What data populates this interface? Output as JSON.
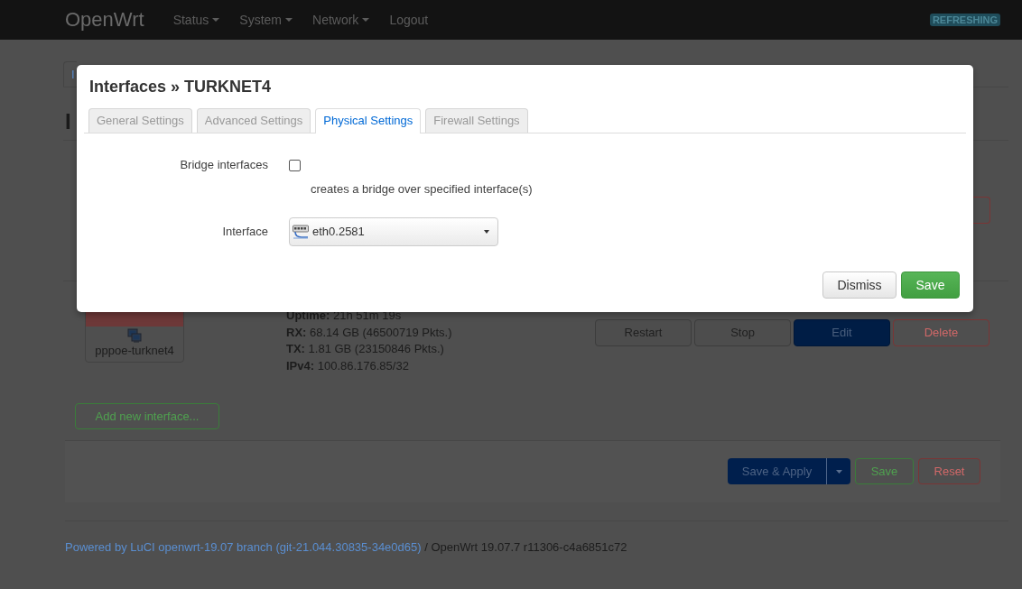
{
  "navbar": {
    "brand": "OpenWrt",
    "menu": [
      {
        "label": "Status",
        "dropdown": true
      },
      {
        "label": "System",
        "dropdown": true
      },
      {
        "label": "Network",
        "dropdown": true
      },
      {
        "label": "Logout",
        "dropdown": false
      }
    ],
    "badge": "REFRESHING"
  },
  "page": {
    "tabs": [
      {
        "label": "I",
        "selected": true
      }
    ],
    "heading": "I",
    "interface": {
      "device": "pppoe-turknet4",
      "details": [
        "**Uptime:** 21h 51m 19s",
        "**RX:** 68.14 GB (46500719 Pkts.)",
        "**TX:** 1.81 GB (23150846 Pkts.)",
        "**IPv4:** 100.86.176.85/32"
      ],
      "actions": [
        {
          "label": "Restart",
          "kind": "default"
        },
        {
          "label": "Stop",
          "kind": "default"
        },
        {
          "label": "Edit",
          "kind": "primary"
        },
        {
          "label": "Delete",
          "kind": "danger"
        }
      ]
    },
    "add_button": "Add new interface...",
    "actions": [
      {
        "label": "Save & Apply",
        "kind": "split"
      },
      {
        "label": "Save",
        "kind": "positive"
      },
      {
        "label": "Reset",
        "kind": "danger"
      }
    ],
    "footer": {
      "link": "Powered by LuCI openwrt-19.07 branch (git-21.044.30835-34e0d65)",
      "text": "/ OpenWrt 19.07.7 r11306-c4a6851c72"
    }
  },
  "modal": {
    "title": "Interfaces » TURKNET4",
    "tabs": [
      {
        "label": "General Settings",
        "selected": false
      },
      {
        "label": "Advanced Settings",
        "selected": false
      },
      {
        "label": "Physical Settings",
        "selected": true
      },
      {
        "label": "Firewall Settings",
        "selected": false
      }
    ],
    "fields": [
      {
        "kind": "checkbox",
        "label": "Bridge interfaces",
        "checked": false,
        "description": "creates a bridge over specified interface(s)"
      },
      {
        "kind": "select",
        "label": "Interface",
        "value": "eth0.2581"
      }
    ],
    "buttons": [
      {
        "label": "Dismiss",
        "kind": "default"
      },
      {
        "label": "Save",
        "kind": "positive"
      }
    ]
  }
}
